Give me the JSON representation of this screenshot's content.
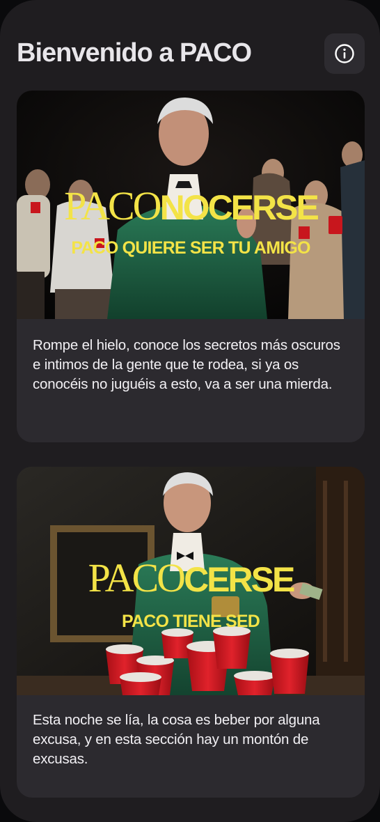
{
  "header": {
    "title": "Bienvenido a PACO",
    "info_icon": "info-circle-icon"
  },
  "games": [
    {
      "logo_light": "PACO",
      "logo_bold": "NOCERSE",
      "tagline": "PACO QUIERE SER TU AMIGO",
      "description": "Rompe el hielo, conoce los secretos más oscuros e intimos de la gente que te rodea, si ya os conocéis no juguéis a esto, va a ser una mierda."
    },
    {
      "logo_light": "PACO",
      "logo_bold": "CERSE",
      "tagline": "PACO TIENE SED",
      "description": "Esta noche se lía, la cosa es beber por alguna excusa, y en esta sección hay un montón de excusas."
    }
  ],
  "colors": {
    "background": "#1f1d20",
    "card": "#2c2a2f",
    "accent_yellow": "#f3e347",
    "cup_red": "#c8161d",
    "jacket_green": "#1f6b4c"
  }
}
